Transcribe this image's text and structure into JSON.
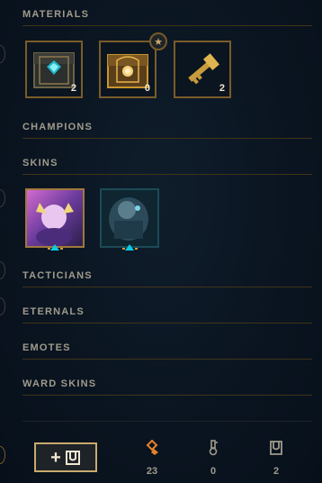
{
  "sections": {
    "materials": "MATERIALS",
    "champions": "CHAMPIONS",
    "skins": "SKINS",
    "tacticians": "TACTICIANS",
    "eternals": "ETERNALS",
    "emotes": "EMOTES",
    "ward_skins": "WARD SKINS"
  },
  "materials": [
    {
      "name": "hextech-chest",
      "count": "2"
    },
    {
      "name": "masterwork-chest",
      "count": "0"
    },
    {
      "name": "hextech-key",
      "count": "2"
    }
  ],
  "skins": [
    {
      "name": "skin-purple-champion"
    },
    {
      "name": "skin-armored-champion"
    }
  ],
  "footer": {
    "orange_essence": "23",
    "key_fragments": "0",
    "chests": "2"
  },
  "colors": {
    "gold": "#c8aa6e",
    "orange_essence": "#e8822a",
    "teal_accent": "#0acbe6"
  }
}
